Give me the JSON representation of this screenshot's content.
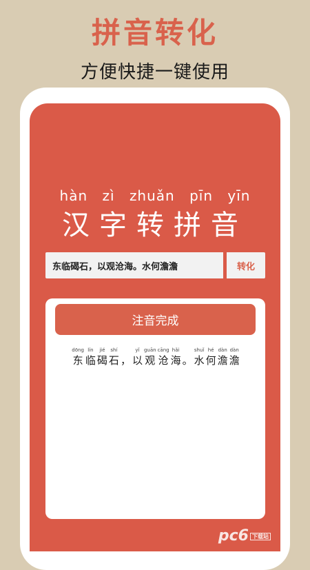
{
  "promo": {
    "title": "拼音转化",
    "subtitle": "方便快捷一键使用"
  },
  "hero": {
    "pinyin": [
      "hàn",
      "zì",
      "zhuǎn",
      "pīn",
      "yīn"
    ],
    "hanzi": "汉字转拼音"
  },
  "input": {
    "value": "东临碣石，以观沧海。水何澹澹"
  },
  "convert_button": {
    "label": "转化"
  },
  "result": {
    "status_label": "注音完成",
    "chars": [
      {
        "py": "dōng",
        "hz": "东"
      },
      {
        "py": "lín",
        "hz": "临"
      },
      {
        "py": "jié",
        "hz": "碣"
      },
      {
        "py": "shí",
        "hz": "石"
      },
      {
        "py": "",
        "hz": "，"
      },
      {
        "py": "yǐ",
        "hz": "以"
      },
      {
        "py": "guān",
        "hz": "观"
      },
      {
        "py": "cāng",
        "hz": "沧"
      },
      {
        "py": "hǎi",
        "hz": "海"
      },
      {
        "py": "",
        "hz": "。"
      },
      {
        "py": "shuǐ",
        "hz": "水"
      },
      {
        "py": "hé",
        "hz": "何"
      },
      {
        "py": "dàn",
        "hz": "澹"
      },
      {
        "py": "dàn",
        "hz": "澹"
      }
    ]
  },
  "watermark": {
    "text": "pc6",
    "badge": "下载站"
  },
  "colors": {
    "accent": "#da5a48",
    "background": "#d9ccb3"
  }
}
